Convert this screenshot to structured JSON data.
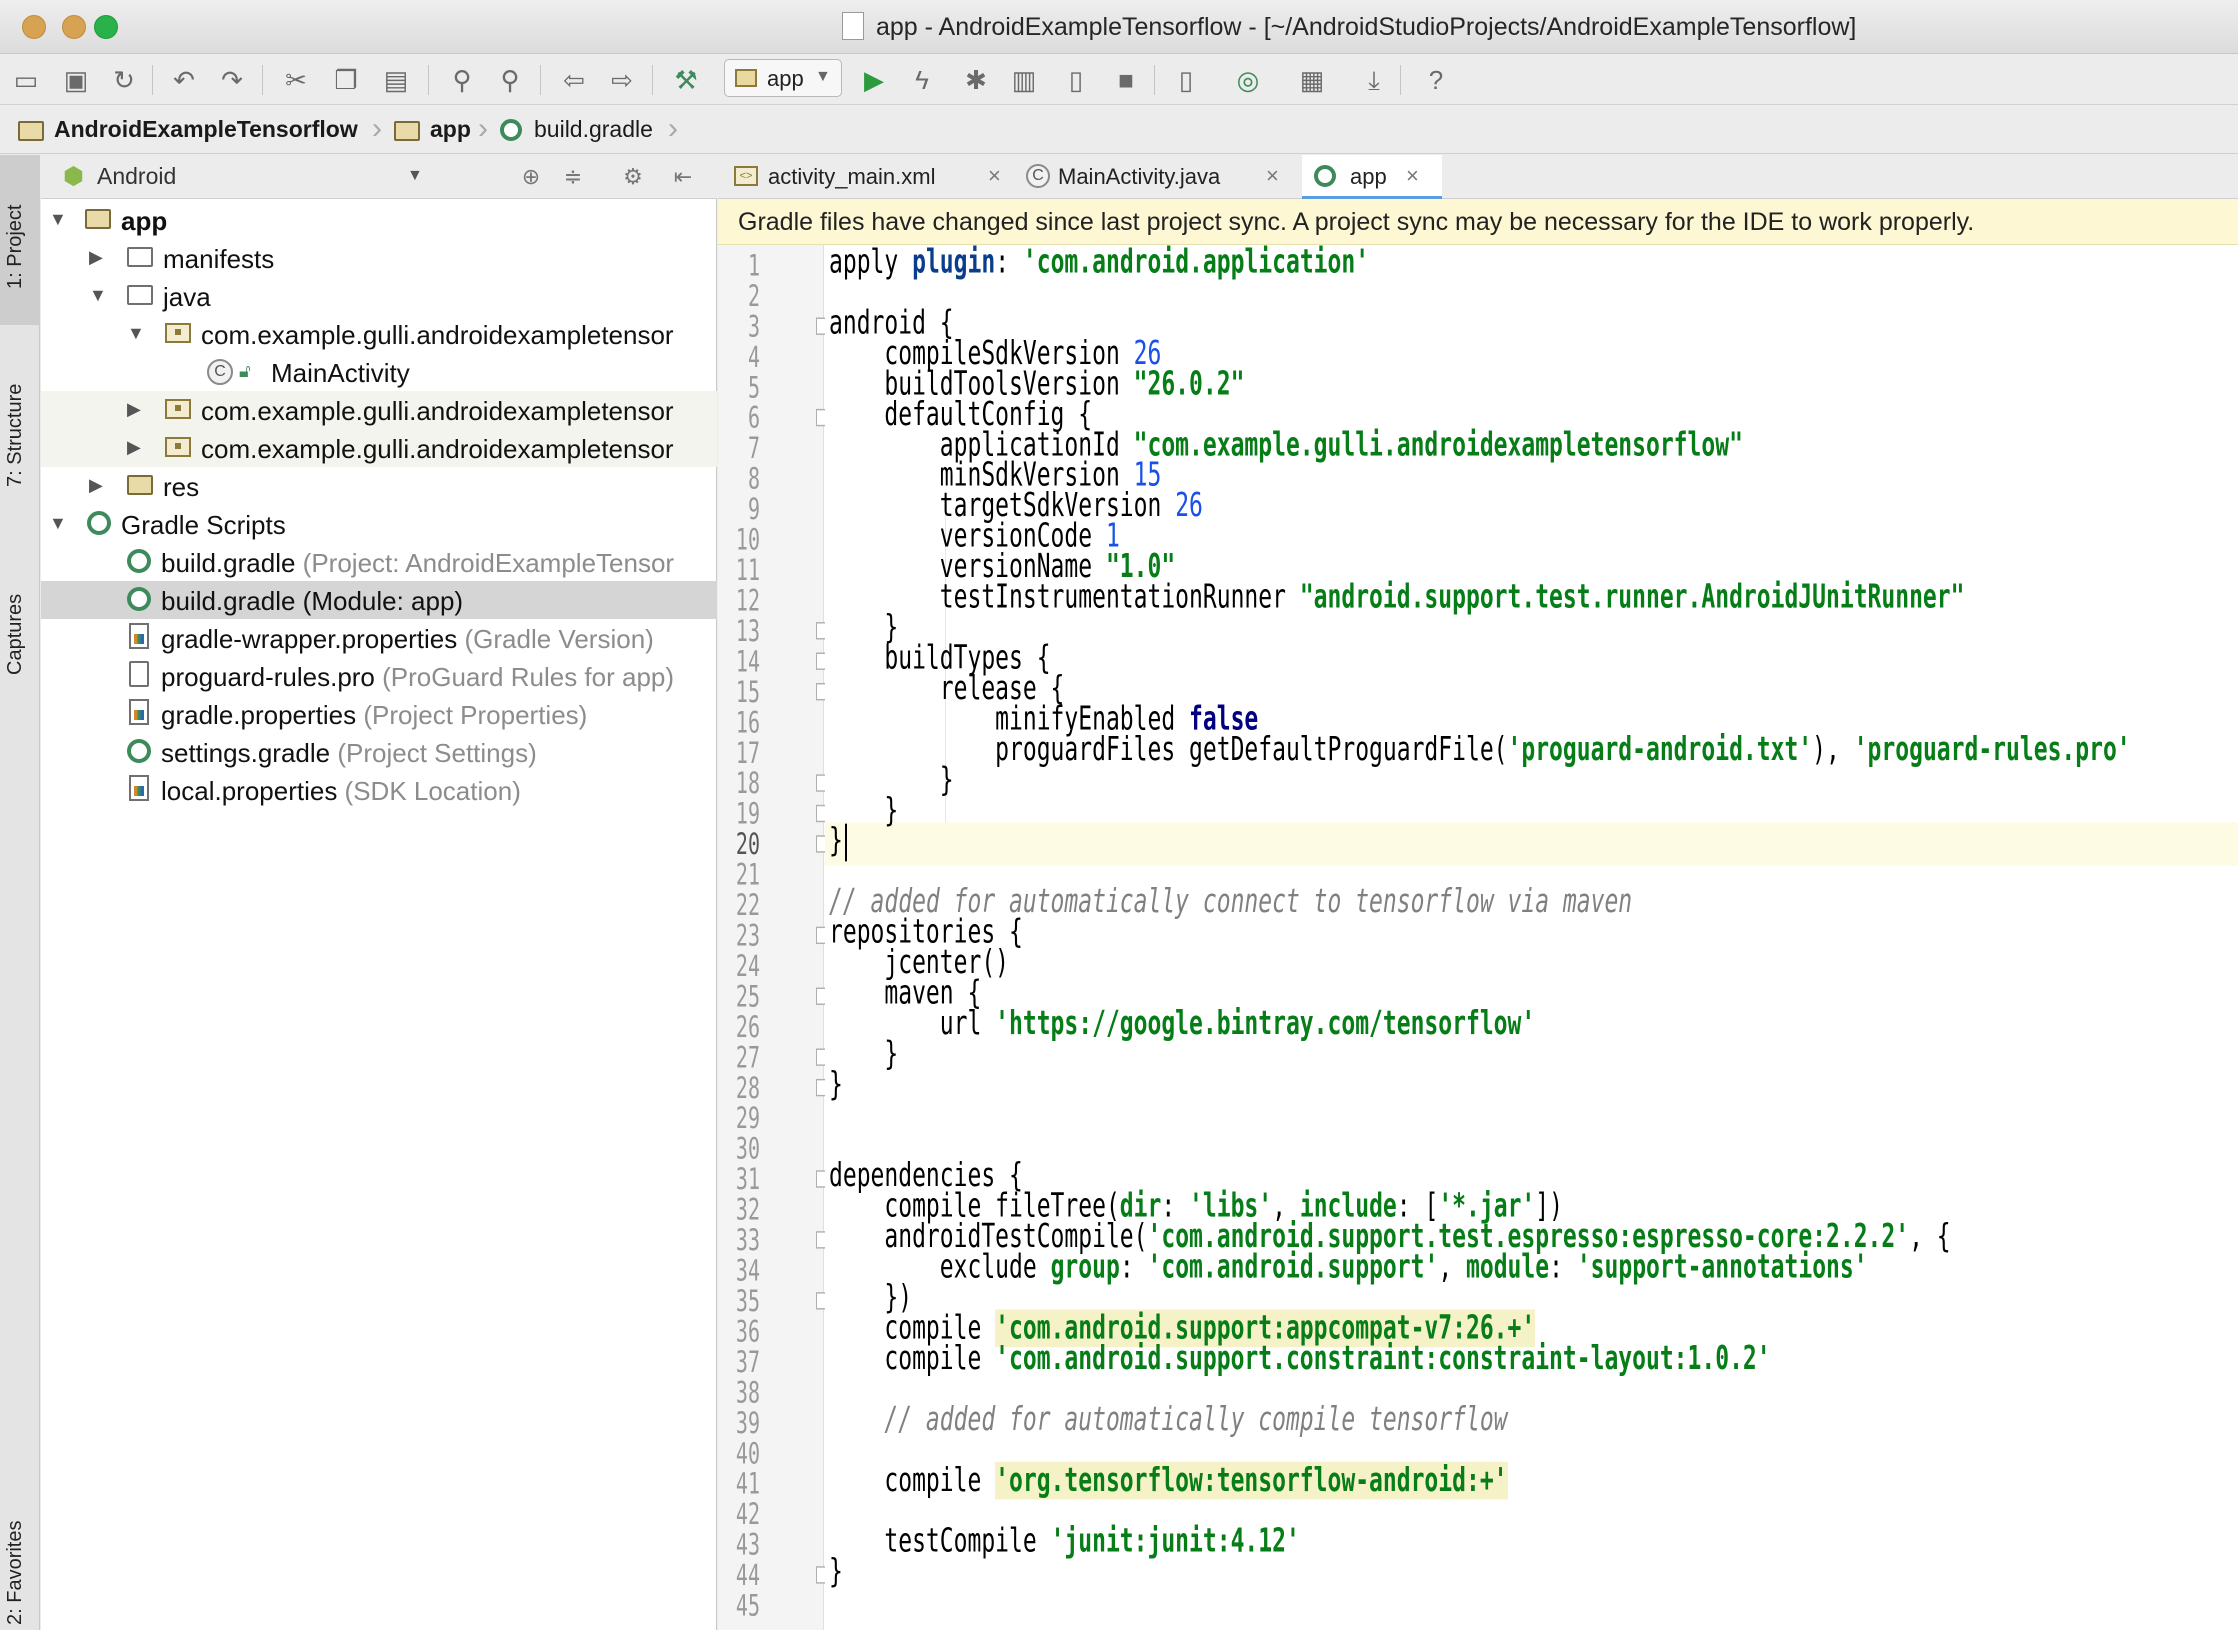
{
  "window": {
    "title": "app - AndroidExampleTensorflow - [~/AndroidStudioProjects/AndroidExampleTensorflow]",
    "controls": [
      "close",
      "minimize",
      "maximize"
    ]
  },
  "toolbar": {
    "run_config": "app",
    "icons": [
      "open-icon",
      "save-icon",
      "sync-icon",
      "undo-icon",
      "redo-icon",
      "cut-icon",
      "copy-icon",
      "paste-icon",
      "find-icon",
      "replace-icon",
      "back-icon",
      "forward-icon",
      "build-icon",
      "run-icon",
      "apply-changes-icon",
      "debug-icon",
      "profile-icon",
      "attach-debugger-icon",
      "stop-icon",
      "avd-manager-icon",
      "sync-gradle-icon",
      "project-structure-icon",
      "sdk-manager-icon",
      "help-icon"
    ]
  },
  "breadcrumb": [
    "AndroidExampleTensorflow",
    "app",
    "build.gradle"
  ],
  "left_stripe": {
    "tabs": [
      "1: Project",
      "7: Structure",
      "Captures",
      "2: Favorites"
    ]
  },
  "project": {
    "view_mode": "Android",
    "tree": [
      {
        "label": "app",
        "hint": "",
        "bold": true
      },
      {
        "label": "manifests",
        "hint": ""
      },
      {
        "label": "java",
        "hint": ""
      },
      {
        "label": "com.example.gulli.androidexampletensor",
        "hint": ""
      },
      {
        "label": "MainActivity",
        "hint": ""
      },
      {
        "label": "com.example.gulli.androidexampletensor",
        "hint": ""
      },
      {
        "label": "com.example.gulli.androidexampletensor",
        "hint": ""
      },
      {
        "label": "res",
        "hint": ""
      },
      {
        "label": "Gradle Scripts",
        "hint": ""
      },
      {
        "label": "build.gradle",
        "hint": "(Project: AndroidExampleTensor"
      },
      {
        "label": "build.gradle",
        "hint": "(Module: app)"
      },
      {
        "label": "gradle-wrapper.properties",
        "hint": "(Gradle Version)"
      },
      {
        "label": "proguard-rules.pro",
        "hint": "(ProGuard Rules for app)"
      },
      {
        "label": "gradle.properties",
        "hint": "(Project Properties)"
      },
      {
        "label": "settings.gradle",
        "hint": "(Project Settings)"
      },
      {
        "label": "local.properties",
        "hint": "(SDK Location)"
      }
    ]
  },
  "editor": {
    "tabs": [
      {
        "label": "activity_main.xml",
        "active": false
      },
      {
        "label": "MainActivity.java",
        "active": false
      },
      {
        "label": "app",
        "active": true
      }
    ],
    "notification": "Gradle files have changed since last project sync. A project sync may be necessary for the IDE to work properly.",
    "current_line": 20,
    "lines": [
      [
        {
          "t": "apply "
        },
        {
          "t": "plugin",
          "c": "kw"
        },
        {
          "t": ": "
        },
        {
          "t": "'com.android.application'",
          "c": "str"
        }
      ],
      [],
      [
        {
          "t": "android {"
        }
      ],
      [
        {
          "t": "    compileSdkVersion "
        },
        {
          "t": "26",
          "c": "num"
        }
      ],
      [
        {
          "t": "    buildToolsVersion "
        },
        {
          "t": "\"26.0.2\"",
          "c": "str"
        }
      ],
      [
        {
          "t": "    defaultConfig {"
        }
      ],
      [
        {
          "t": "        applicationId "
        },
        {
          "t": "\"com.example.gulli.androidexampletensorflow\"",
          "c": "str"
        }
      ],
      [
        {
          "t": "        minSdkVersion "
        },
        {
          "t": "15",
          "c": "num"
        }
      ],
      [
        {
          "t": "        targetSdkVersion "
        },
        {
          "t": "26",
          "c": "num"
        }
      ],
      [
        {
          "t": "        versionCode "
        },
        {
          "t": "1",
          "c": "num"
        }
      ],
      [
        {
          "t": "        versionName "
        },
        {
          "t": "\"1.0\"",
          "c": "str"
        }
      ],
      [
        {
          "t": "        testInstrumentationRunner "
        },
        {
          "t": "\"android.support.test.runner.AndroidJUnitRunner\"",
          "c": "str"
        }
      ],
      [
        {
          "t": "    }"
        }
      ],
      [
        {
          "t": "    buildTypes {"
        }
      ],
      [
        {
          "t": "        release {"
        }
      ],
      [
        {
          "t": "            minifyEnabled "
        },
        {
          "t": "false",
          "c": "kw2"
        }
      ],
      [
        {
          "t": "            proguardFiles getDefaultProguardFile("
        },
        {
          "t": "'proguard-android.txt'",
          "c": "str"
        },
        {
          "t": "), "
        },
        {
          "t": "'proguard-rules.pro'",
          "c": "str"
        }
      ],
      [
        {
          "t": "        }"
        }
      ],
      [
        {
          "t": "    }"
        }
      ],
      [
        {
          "t": "}"
        }
      ],
      [],
      [
        {
          "t": "// added for automatically connect to tensorflow via maven",
          "c": "cm"
        }
      ],
      [
        {
          "t": "repositories {"
        }
      ],
      [
        {
          "t": "    jcenter()"
        }
      ],
      [
        {
          "t": "    maven {"
        }
      ],
      [
        {
          "t": "        url "
        },
        {
          "t": "'https://google.bintray.com/tensorflow'",
          "c": "str"
        }
      ],
      [
        {
          "t": "    }"
        }
      ],
      [
        {
          "t": "}"
        }
      ],
      [],
      [],
      [
        {
          "t": "dependencies {"
        }
      ],
      [
        {
          "t": "    compile fileTree("
        },
        {
          "t": "dir",
          "c": "named"
        },
        {
          "t": ": "
        },
        {
          "t": "'libs'",
          "c": "str"
        },
        {
          "t": ", "
        },
        {
          "t": "include",
          "c": "named"
        },
        {
          "t": ": ["
        },
        {
          "t": "'*.jar'",
          "c": "str"
        },
        {
          "t": "])"
        }
      ],
      [
        {
          "t": "    androidTestCompile("
        },
        {
          "t": "'com.android.support.test.espresso:espresso-core:2.2.2'",
          "c": "str"
        },
        {
          "t": ", {"
        }
      ],
      [
        {
          "t": "        exclude "
        },
        {
          "t": "group",
          "c": "named"
        },
        {
          "t": ": "
        },
        {
          "t": "'com.android.support'",
          "c": "str"
        },
        {
          "t": ", "
        },
        {
          "t": "module",
          "c": "named"
        },
        {
          "t": ": "
        },
        {
          "t": "'support-annotations'",
          "c": "str"
        }
      ],
      [
        {
          "t": "    })"
        }
      ],
      [
        {
          "t": "    compile "
        },
        {
          "t": "'com.android.support:appcompat-v7:26.+'",
          "c": "str hlbg"
        }
      ],
      [
        {
          "t": "    compile "
        },
        {
          "t": "'com.android.support.constraint:constraint-layout:1.0.2'",
          "c": "str"
        }
      ],
      [],
      [
        {
          "t": "    // added for automatically compile tensorflow",
          "c": "cm"
        }
      ],
      [],
      [
        {
          "t": "    compile "
        },
        {
          "t": "'org.tensorflow:tensorflow-android:+'",
          "c": "str hlbg"
        }
      ],
      [],
      [
        {
          "t": "    testCompile "
        },
        {
          "t": "'junit:junit:4.12'",
          "c": "str"
        }
      ],
      [
        {
          "t": "}"
        }
      ],
      []
    ],
    "line_numbers": [
      "1",
      "2",
      "3",
      "4",
      "5",
      "6",
      "7",
      "8",
      "9",
      "10",
      "11",
      "12",
      "13",
      "14",
      "15",
      "16",
      "17",
      "18",
      "19",
      "20",
      "21",
      "22",
      "23",
      "24",
      "25",
      "26",
      "27",
      "28",
      "29",
      "30",
      "31",
      "32",
      "33",
      "34",
      "35",
      "36",
      "37",
      "38",
      "39",
      "40",
      "41",
      "42",
      "43",
      "44",
      "45"
    ]
  }
}
